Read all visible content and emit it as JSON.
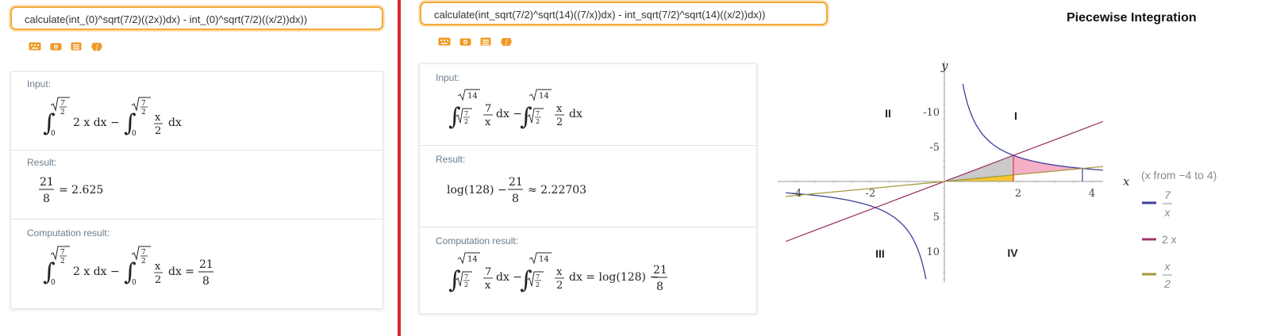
{
  "left": {
    "query": "calculate(int_(0)^sqrt(7/2)((2x))dx) - int_(0)^sqrt(7/2)((x/2))dx))",
    "input_title": "Input:",
    "result_title": "Result:",
    "result_value": "21/8 = 2.625",
    "computation_title": "Computation result:",
    "input_math": "∫_0^√(7/2) 2 x dx − ∫_0^√(7/2) x/2 dx",
    "computation_math": "∫_0^√(7/2) 2 x dx − ∫_0^√(7/2) x/2 dx = 21/8"
  },
  "right": {
    "query": "calculate(int_sqrt(7/2)^sqrt(14)((7/x))dx) - int_sqrt(7/2)^sqrt(14)((x/2))dx))",
    "input_title": "Input:",
    "result_title": "Result:",
    "result_value": "log(128) − 21/8 ≈ 2.22703",
    "computation_title": "Computation result:",
    "input_math": "∫_√(7/2)^√14 7/x dx − ∫_√(7/2)^√14 x/2 dx",
    "computation_math": "∫_√(7/2)^√14 7/x dx − ∫_√(7/2)^√14 x/2 dx = log(128) − 21/8"
  },
  "toolbar_icons": [
    "keyboard-icon",
    "camera-icon",
    "list-icon",
    "extended-keyboard-icon"
  ],
  "plot": {
    "title": "Piecewise Integration",
    "x_axis_label": "x",
    "y_axis_label": "y",
    "x_ticks": [
      "-4",
      "-2",
      "2",
      "4"
    ],
    "y_ticks": [
      "10",
      "5",
      "-5",
      "-10"
    ],
    "quadrants": [
      "I",
      "II",
      "III",
      "IV"
    ],
    "range_note": "(x from −4 to 4)",
    "legend": [
      {
        "label": "7/x",
        "color": "#3b3f9a"
      },
      {
        "label": "2 x",
        "color": "#9c3a6b"
      },
      {
        "label": "x/2",
        "color": "#a59a3c"
      }
    ]
  },
  "chart_data": {
    "type": "line",
    "title": "Piecewise Integration",
    "xlabel": "x",
    "ylabel": "y",
    "xlim": [
      -4.3,
      4.3
    ],
    "ylim": [
      -14,
      14
    ],
    "x_ticks": [
      -4,
      -2,
      2,
      4
    ],
    "y_ticks": [
      -10,
      -5,
      5,
      10
    ],
    "series": [
      {
        "name": "7/x",
        "function": "7/x",
        "color": "#3b3f9a"
      },
      {
        "name": "2 x",
        "function": "2x",
        "color": "#9c3a6b"
      },
      {
        "name": "x/2",
        "function": "x/2",
        "color": "#a59a3c"
      }
    ],
    "shaded_regions": [
      {
        "between": [
          "2 x",
          "x/2"
        ],
        "x_from": 0,
        "x_to": 1.8708,
        "color": "#c4c4c4"
      },
      {
        "under": "x/2",
        "x_from": 0,
        "x_to": 1.8708,
        "color": "#f3c11c"
      },
      {
        "between": [
          "7/x",
          "x/2"
        ],
        "x_from": 1.8708,
        "x_to": 3.7417,
        "color": "#f4a6c0"
      }
    ],
    "vertical_markers": [
      {
        "x": 1.8708,
        "color": "#d33"
      },
      {
        "x": 3.7417,
        "color": "#3b3f9a"
      }
    ],
    "annotations": [
      "I",
      "II",
      "III",
      "IV",
      "(x from −4 to 4)"
    ]
  }
}
